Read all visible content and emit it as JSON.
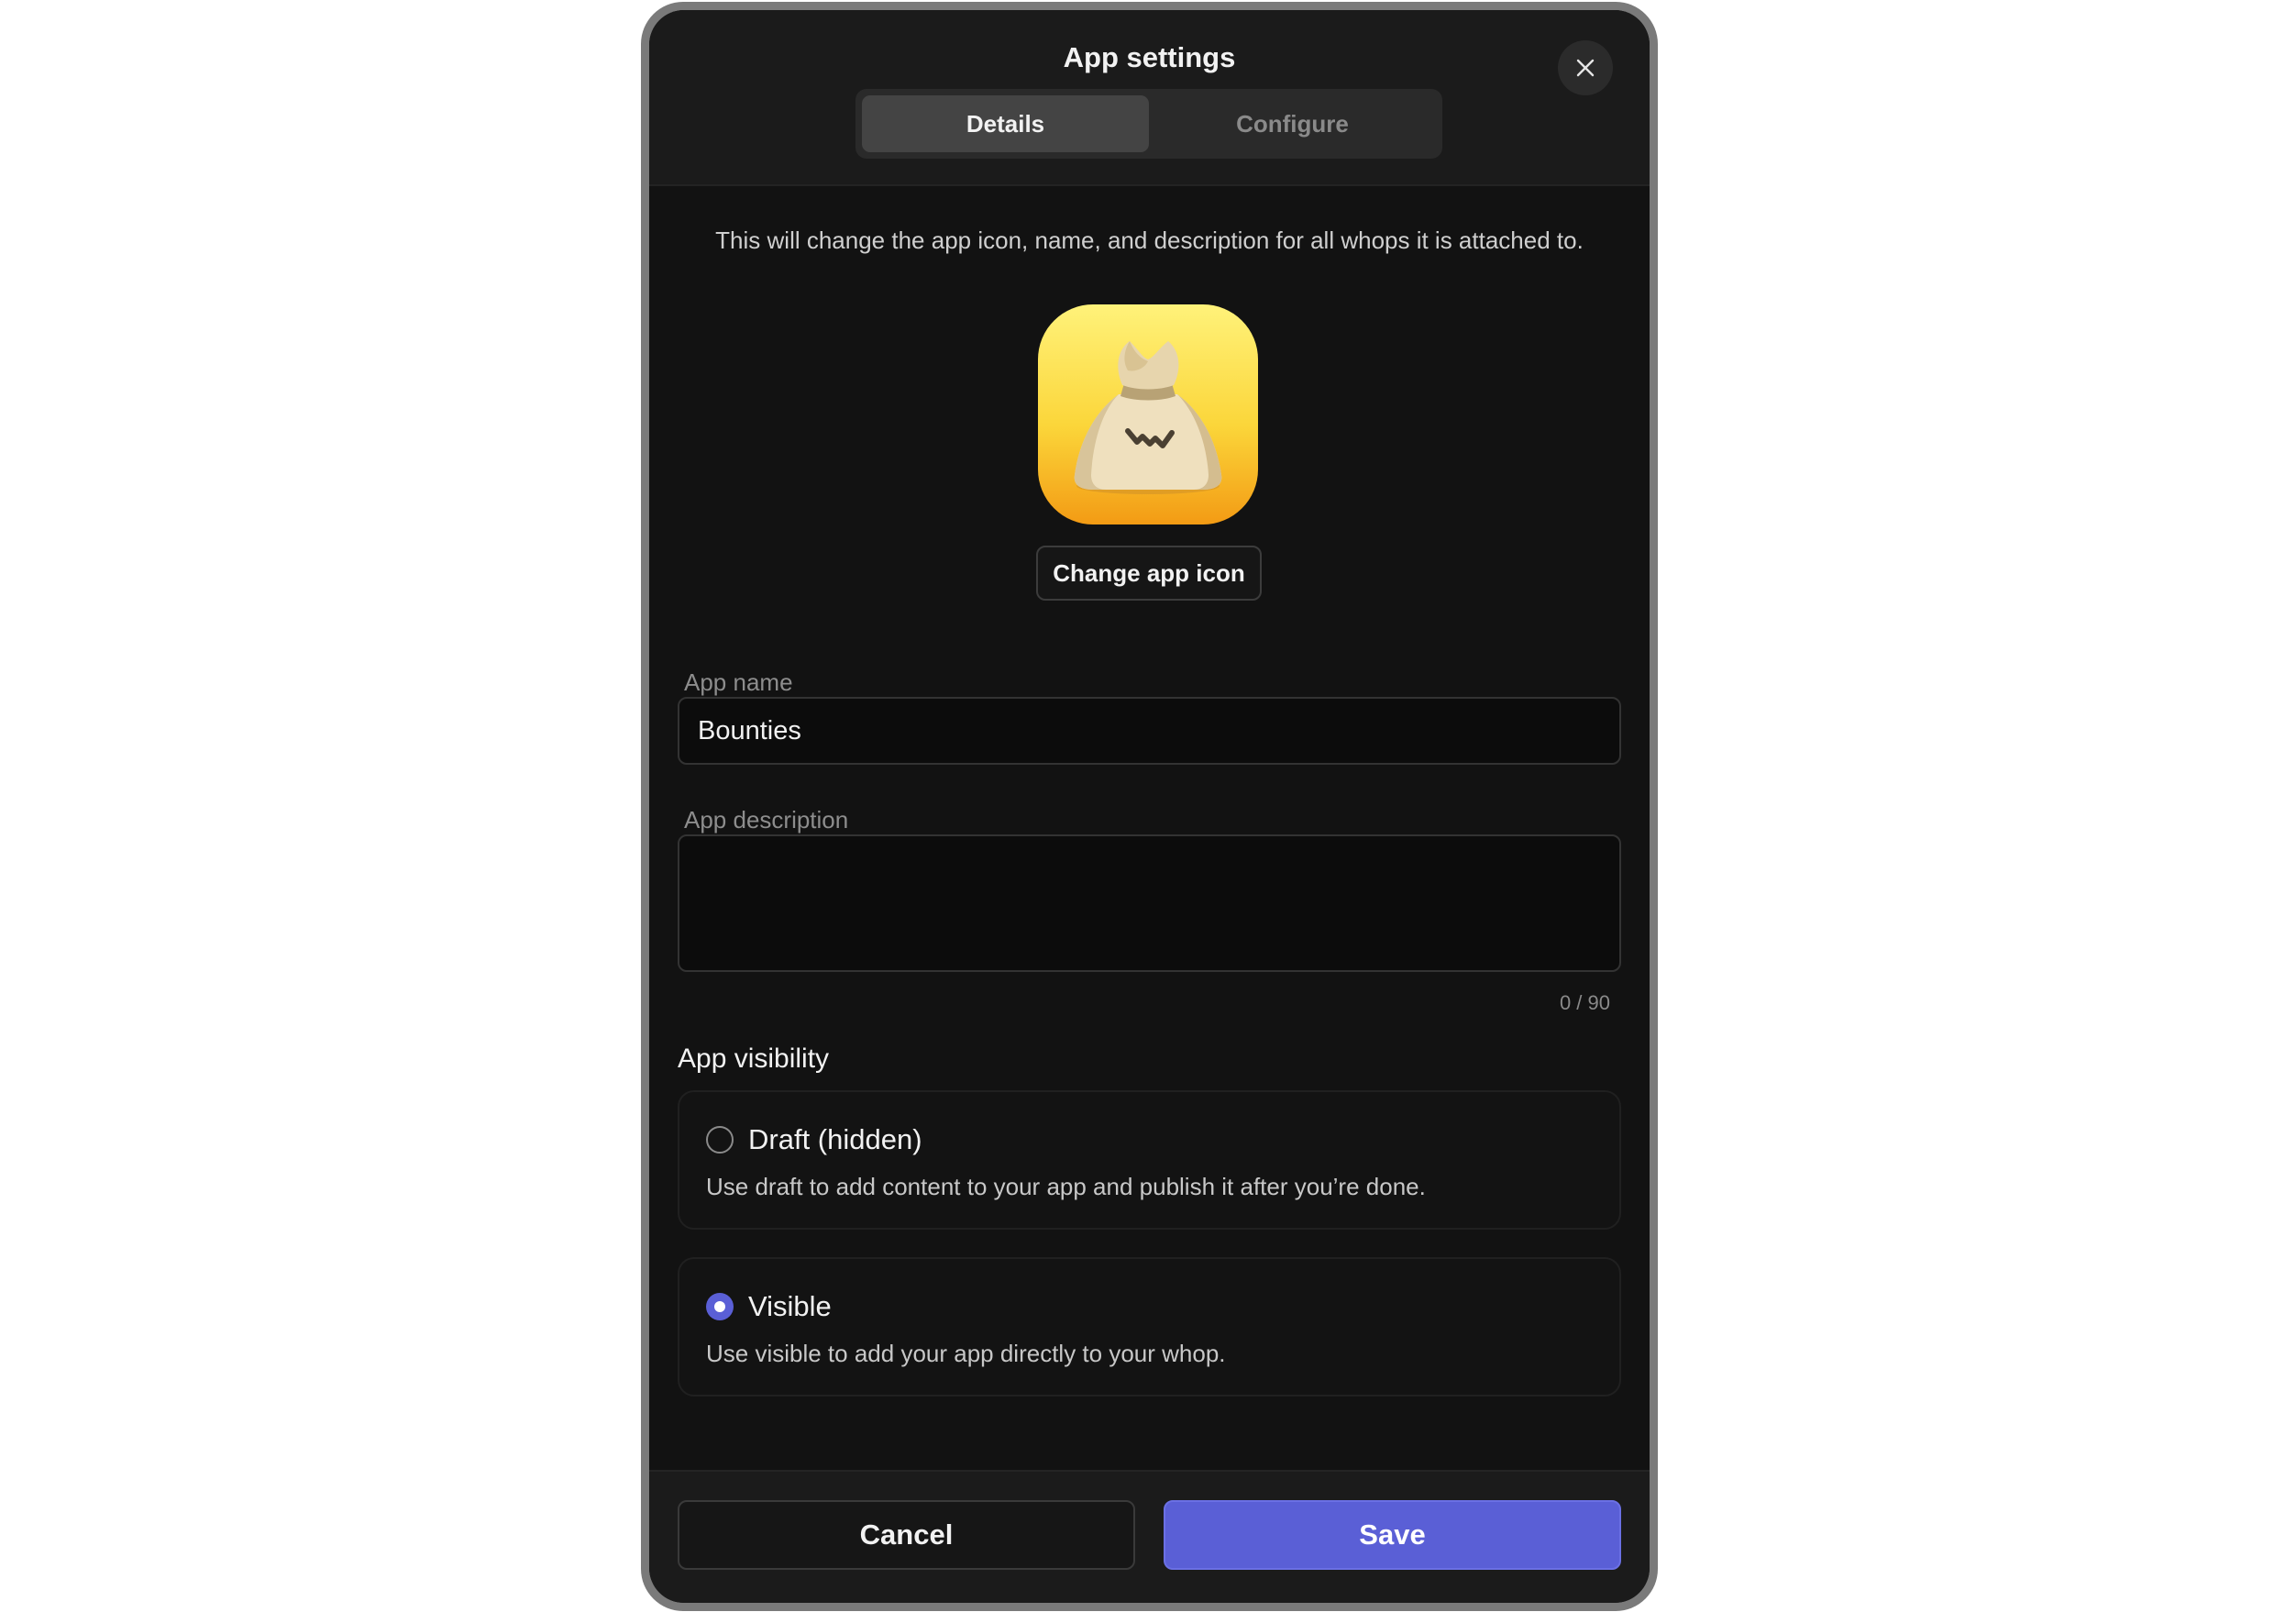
{
  "modal": {
    "title": "App settings",
    "tabs": [
      {
        "label": "Details",
        "active": true
      },
      {
        "label": "Configure",
        "active": false
      }
    ],
    "info_text": "This will change the app icon, name, and description for all whops it is attached to.",
    "change_icon_label": "Change app icon",
    "app_name": {
      "label": "App name",
      "value": "Bounties"
    },
    "app_description": {
      "label": "App description",
      "value": "",
      "char_count": "0 / 90"
    },
    "visibility": {
      "heading": "App visibility",
      "options": [
        {
          "title": "Draft (hidden)",
          "description": "Use draft to add content to your app and publish it after you’re done.",
          "selected": false
        },
        {
          "title": "Visible",
          "description": "Use visible to add your app directly to your whop.",
          "selected": true
        }
      ]
    },
    "footer": {
      "cancel_label": "Cancel",
      "save_label": "Save"
    }
  },
  "icons": {
    "close": "close-icon",
    "app_icon": "money-bag-icon"
  },
  "colors": {
    "accent": "#5a5fd6",
    "background": "#121212",
    "panel": "#1b1b1b"
  }
}
